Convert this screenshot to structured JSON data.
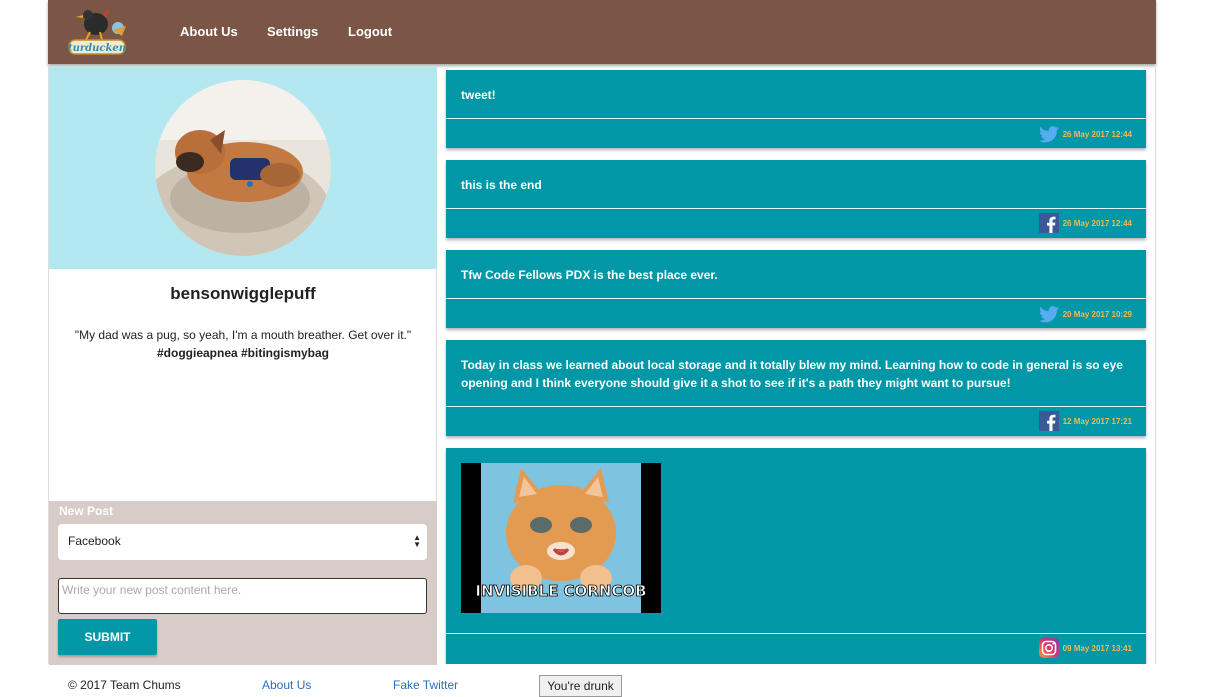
{
  "header": {
    "logo_text": "turducken",
    "nav": [
      {
        "label": "About Us"
      },
      {
        "label": "Settings"
      },
      {
        "label": "Logout"
      }
    ],
    "bg_color": "#7b5646"
  },
  "profile": {
    "username": "bensonwigglepuff",
    "bio": "\"My dad was a pug, so yeah, I'm a mouth breather. Get over it.\"",
    "tags": "#doggieapnea #bitingismybag"
  },
  "new_post": {
    "label": "New Post",
    "platform_selected": "Facebook",
    "content_placeholder": "Write your new post content here.",
    "submit_label": "SUBMIT"
  },
  "feed": {
    "posts": [
      {
        "text": "tweet!",
        "platform": "twitter-icon",
        "date": "26 May 2017 12:44"
      },
      {
        "text": "this is the end",
        "platform": "facebook-icon",
        "date": "26 May 2017 12:44"
      },
      {
        "text": "Tfw Code Fellows PDX is the best place ever.",
        "platform": "twitter-icon",
        "date": "20 May 2017 10:29"
      },
      {
        "text": "Today in class we learned about local storage and it totally blew my mind. Learning how to code in general is so eye opening and I think everyone should give it a shot to see if it's a path they might want to pursue!",
        "platform": "facebook-icon",
        "date": "12 May 2017 17:21"
      },
      {
        "image_caption": "INVISIBLE CORNCOB",
        "platform": "instagram-icon",
        "date": "09 May 2017 13:41"
      }
    ]
  },
  "footer": {
    "copyright": "© 2017 Team Chums",
    "about_link": "About Us",
    "twitter_link": "Fake Twitter",
    "button_label": "You're drunk"
  },
  "colors": {
    "accent": "#0097a7",
    "profile_bg": "#b3e8f0",
    "newpost_bg": "#d7ccc8",
    "date": "#f7b94a"
  }
}
